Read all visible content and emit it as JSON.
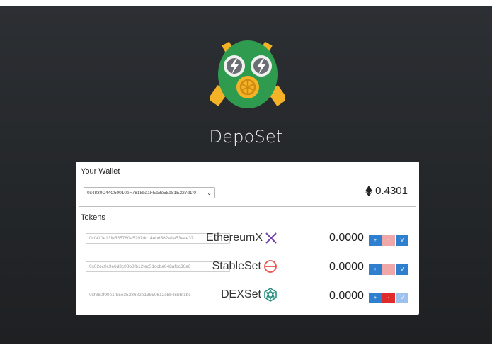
{
  "app": {
    "title": "DepoSet"
  },
  "wallet": {
    "heading": "Your Wallet",
    "selected_address": "0x4830C44C50010eF7818ba1FEa8e58a81E227d1f0",
    "balance": "0.4301",
    "balance_icon": "ethereum-icon"
  },
  "tokens": {
    "heading": "Tokens",
    "items": [
      {
        "address": "0xfa10e13fe555760a5297dc14eb6562a1a53e4e37",
        "name": "EthereumX",
        "icon": "ethereumx-icon",
        "icon_color": "#6f3ea8",
        "balance": "0.0000",
        "plus": "+",
        "minus": "-",
        "v": "V"
      },
      {
        "address": "0x02ec0c9e6d3c08b8fb12fec51ccba048afbc36a6",
        "name": "StableSet",
        "icon": "stableset-icon",
        "icon_color": "#e8544f",
        "balance": "0.0000",
        "plus": "+",
        "minus": "-",
        "v": "V"
      },
      {
        "address": "0xf860f90e1f55e3528682e18850612cbb45bbf1bc",
        "name": "DEXSet",
        "icon": "dexset-icon",
        "icon_color": "#1f8a7a",
        "balance": "0.0000",
        "plus": "+",
        "minus": "-",
        "v": "V"
      }
    ]
  },
  "colors": {
    "background": "#2a2d30",
    "button_blue": "#2f7fcf",
    "button_red": "#e02b2b",
    "button_pink": "#f0a7a7"
  }
}
